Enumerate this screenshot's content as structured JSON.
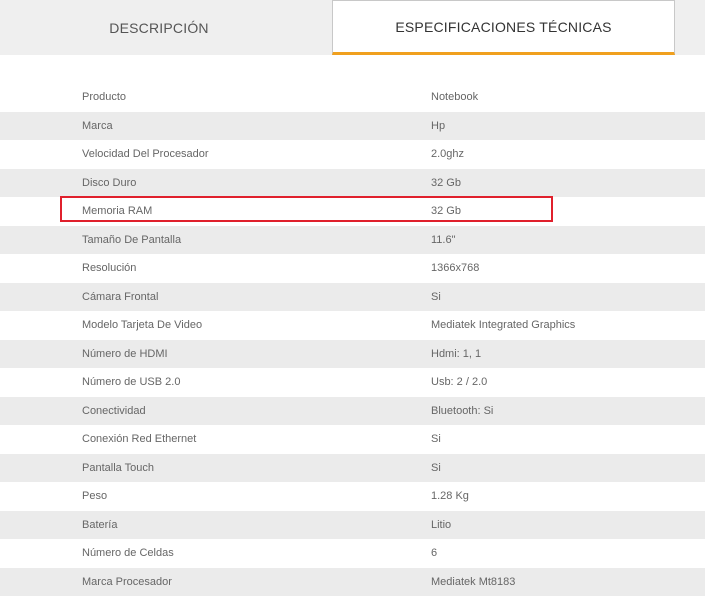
{
  "tabs": {
    "description_label": "DESCRIPCIÓN",
    "specs_label": "ESPECIFICACIONES TÉCNICAS"
  },
  "colors": {
    "active_tab_underline": "#f0a01e",
    "highlight_border": "#e0202c",
    "row_shade": "#ebebeb",
    "tab_bar_bg": "#efefef"
  },
  "specs": [
    {
      "label": "Producto",
      "value": "Notebook"
    },
    {
      "label": "Marca",
      "value": "Hp"
    },
    {
      "label": "Velocidad Del Procesador",
      "value": "2.0ghz"
    },
    {
      "label": "Disco Duro",
      "value": "32 Gb"
    },
    {
      "label": "Memoria RAM",
      "value": "32 Gb"
    },
    {
      "label": "Tamaño De Pantalla",
      "value": "11.6\""
    },
    {
      "label": "Resolución",
      "value": "1366x768"
    },
    {
      "label": "Cámara Frontal",
      "value": "Si"
    },
    {
      "label": "Modelo Tarjeta De Video",
      "value": "Mediatek Integrated Graphics"
    },
    {
      "label": "Número de HDMI",
      "value": "Hdmi: 1, 1"
    },
    {
      "label": "Número de USB 2.0",
      "value": "Usb: 2 / 2.0"
    },
    {
      "label": "Conectividad",
      "value": "Bluetooth: Si"
    },
    {
      "label": "Conexión Red Ethernet",
      "value": "Si"
    },
    {
      "label": "Pantalla Touch",
      "value": "Si"
    },
    {
      "label": "Peso",
      "value": "1.28 Kg"
    },
    {
      "label": "Batería",
      "value": "Litio"
    },
    {
      "label": "Número de Celdas",
      "value": "6"
    },
    {
      "label": "Marca Procesador",
      "value": "Mediatek Mt8183"
    }
  ]
}
